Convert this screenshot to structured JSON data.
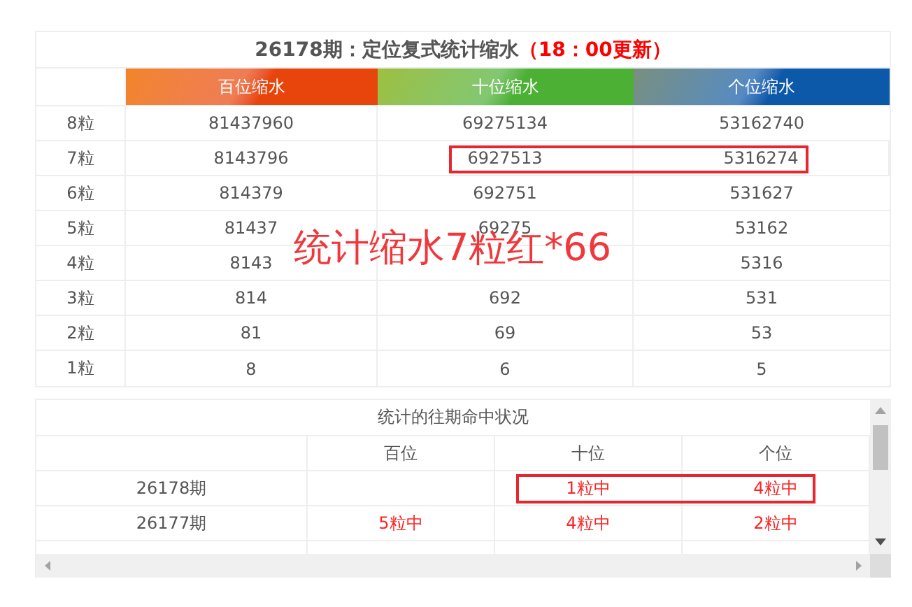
{
  "forecast_table": {
    "title": "26178期：定位复式统计缩水",
    "update_note": "（18：00更新）",
    "columns": [
      {
        "label": "百位缩水",
        "color": "#e8450c"
      },
      {
        "label": "十位缩水",
        "color": "#4cb035"
      },
      {
        "label": "个位缩水",
        "color": "#0c58a9"
      }
    ],
    "rows": [
      {
        "label": "8粒",
        "values": {
          "hundreds": "81437960",
          "tens": "69275134",
          "units": "53162740"
        },
        "marked": false
      },
      {
        "label": "7粒",
        "values": {
          "hundreds": "8143796",
          "tens": "6927513",
          "units": "5316274"
        },
        "marked": true
      },
      {
        "label": "6粒",
        "values": {
          "hundreds": "814379",
          "tens": "692751",
          "units": "531627"
        },
        "marked": false
      },
      {
        "label": "5粒",
        "values": {
          "hundreds": "81437",
          "tens": "69275",
          "units": "53162"
        },
        "marked": false
      },
      {
        "label": "4粒",
        "values": {
          "hundreds": "8143",
          "units": "5316"
        },
        "marked": false
      },
      {
        "label": "3粒",
        "values": {
          "hundreds": "814",
          "tens": "692",
          "units": "531"
        },
        "marked": false
      },
      {
        "label": "2粒",
        "values": {
          "hundreds": "81",
          "tens": "69",
          "units": "53"
        },
        "marked": false
      },
      {
        "label": "1粒",
        "values": {
          "hundreds": "8",
          "tens": "6",
          "units": "5"
        },
        "marked": false
      }
    ]
  },
  "annotation": {
    "text": "统计缩水7粒红*66"
  },
  "history_table": {
    "title": "统计的往期命中状况",
    "columns": [
      "百位",
      "十位",
      "个位"
    ],
    "rows": [
      {
        "period": "26178期",
        "hits": {
          "tens": "1粒中",
          "units": "4粒中"
        },
        "marked": true
      },
      {
        "period": "26177期",
        "hits": {
          "hundreds": "5粒中",
          "tens": "4粒中",
          "units": "2粒中"
        },
        "marked": false
      }
    ]
  }
}
